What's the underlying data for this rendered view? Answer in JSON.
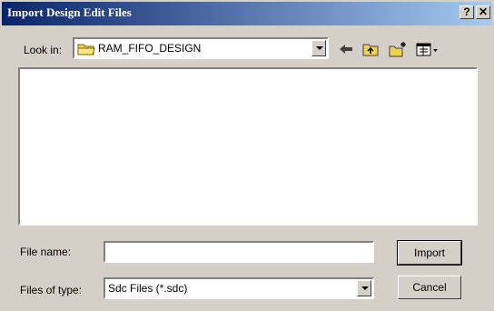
{
  "window": {
    "title": "Import Design Edit Files",
    "help_glyph": "?",
    "close_glyph": "✕"
  },
  "lookin": {
    "label": "Look in:",
    "value": "RAM_FIFO_DESIGN"
  },
  "toolbar": {
    "back_icon": "back-arrow-icon",
    "up_icon": "up-folder-icon",
    "new_icon": "new-folder-icon",
    "view_icon": "view-menu-icon"
  },
  "filename": {
    "label": "File name:",
    "value": ""
  },
  "filetype": {
    "label": "Files of type:",
    "value": "Sdc Files (*.sdc)"
  },
  "buttons": {
    "import": "Import",
    "cancel": "Cancel"
  }
}
